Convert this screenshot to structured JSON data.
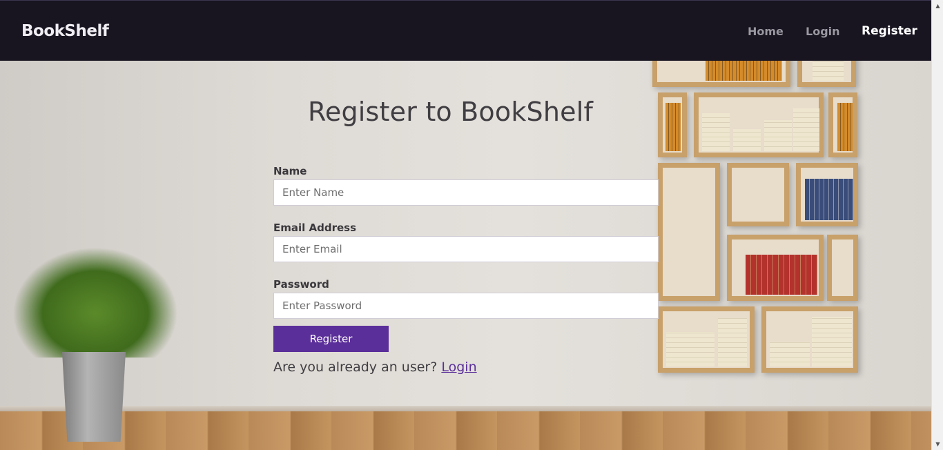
{
  "nav": {
    "brand": "BookShelf",
    "home": "Home",
    "login": "Login",
    "register": "Register"
  },
  "form": {
    "title": "Register to BookShelf",
    "name_label": "Name",
    "name_placeholder": "Enter Name",
    "email_label": "Email Address",
    "email_placeholder": "Enter Email",
    "password_label": "Password",
    "password_placeholder": "Enter Password",
    "submit_label": "Register",
    "already_text": "Are you already an user?",
    "login_link": "Login"
  },
  "colors": {
    "navbar": "#181420",
    "accent": "#5b2f9a"
  }
}
